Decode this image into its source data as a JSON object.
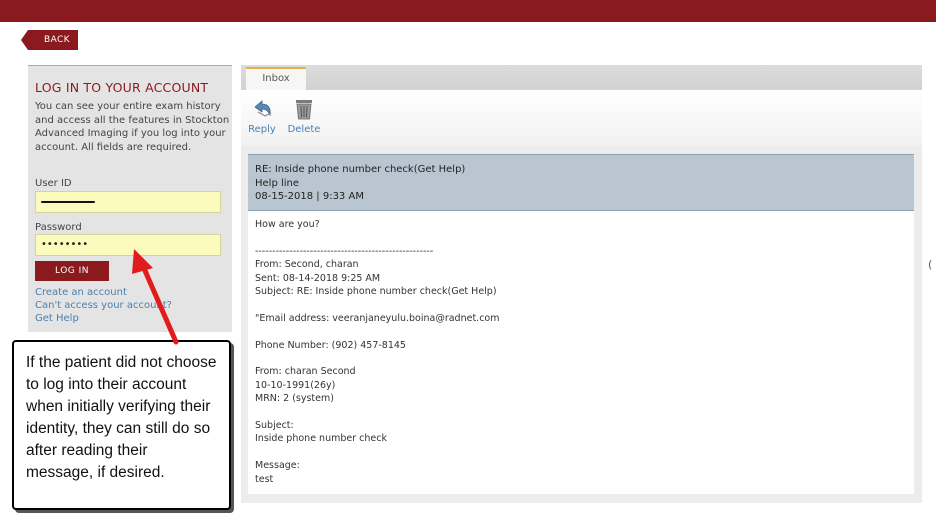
{
  "colors": {
    "brand": "#8b1a1f",
    "link": "#4a7fb0",
    "input_bg": "#fbfbbd",
    "header_bg": "#b9c6d1",
    "tab_accent": "#e8b04a"
  },
  "back_label": "BACK",
  "login": {
    "title": "LOG IN TO YOUR ACCOUNT",
    "description": "You can see your entire exam history and access all the features in Stockton Advanced Imaging if you log into your account. All fields are required.",
    "userid_label": "User ID",
    "password_label": "Password",
    "password_value": "••••••••",
    "button_label": "LOG IN",
    "links": [
      "Create an account",
      "Can't access your account?",
      "Get Help"
    ]
  },
  "mail": {
    "tab_label": "Inbox",
    "toolbar": {
      "reply_label": "Reply",
      "delete_label": "Delete",
      "reply_icon": "reply-arrow-icon",
      "delete_icon": "trash-can-icon"
    },
    "header": {
      "subject": "RE: Inside phone number check(Get Help)",
      "category": "Help line",
      "datetime": "08-15-2018 | 9:33 AM"
    },
    "body_lines": [
      "How are you?",
      "",
      "----------------------------------------------------",
      "From: Second, charan",
      "Sent: 08-14-2018 9:25 AM",
      "Subject: RE: Inside phone number check(Get Help)",
      "",
      "\"Email address: veeranjaneyulu.boina@radnet.com",
      "",
      "Phone Number: (902) 457-8145",
      "",
      "From: charan Second",
      "10-10-1991(26y)",
      "MRN: 2 (system)",
      "",
      "Subject:",
      "Inside phone number check",
      "",
      "Message:",
      "test"
    ]
  },
  "callout": {
    "text": "If the patient did not choose to log into their account when initially verifying their identity, they can still do so after reading their message, if desired."
  }
}
